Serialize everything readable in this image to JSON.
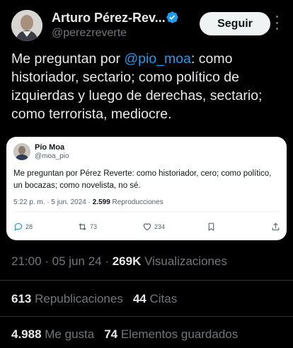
{
  "author": {
    "name": "Arturo Pérez-Rev...",
    "handle": "@perezreverte",
    "follow_label": "Seguir"
  },
  "tweet": {
    "text_before": "Me preguntan por ",
    "mention": "@pio_moa",
    "text_after": ": como historiador, sectario; como político de izquierdas y luego de derechas, sectario; como terrorista, mediocre."
  },
  "quoted": {
    "name": "Pío Moa",
    "handle": "@moa_pio",
    "text": "Me preguntan por Pérez Reverte: como historiador, cero; como político, un bocazas; como novelista, no sé.",
    "time": "5:22 p. m. · 5 jun. 2024 · ",
    "views_count": "2.599",
    "views_label": " Reproducciones",
    "replies": "28",
    "retweets": "73",
    "likes": "234"
  },
  "meta": {
    "time": "21:00 · 05 jun 24 · ",
    "views_count": "269K",
    "views_label": " Visualizaciones"
  },
  "stats": {
    "reposts_count": "613",
    "reposts_label": " Republicaciones",
    "quotes_count": "44",
    "quotes_label": " Citas",
    "likes_count": "4.988",
    "likes_label": " Me gusta",
    "bookmarks_count": "74",
    "bookmarks_label": " Elementos guardados"
  },
  "colors": {
    "background": "#000000",
    "accent": "#1d9bf0",
    "muted": "#71767b",
    "follow_bg": "#eff3f4"
  },
  "icons": [
    "verified-badge-icon",
    "more-icon",
    "reply-icon",
    "retweet-icon",
    "like-icon",
    "bookmark-icon",
    "share-icon"
  ]
}
